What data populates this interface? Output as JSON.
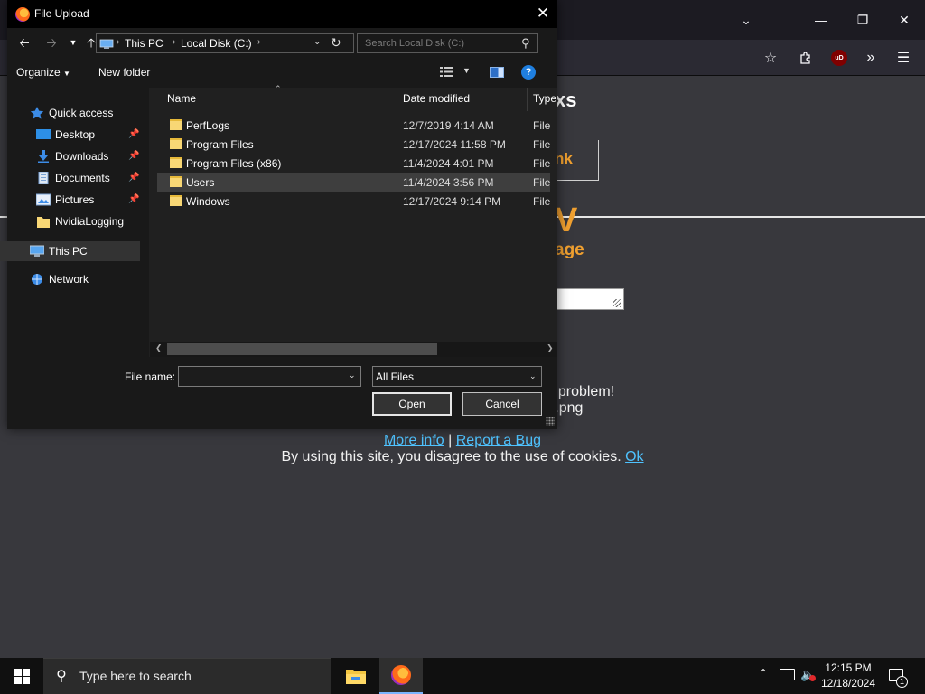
{
  "dialog": {
    "title": "File Upload",
    "address": {
      "crumbs": [
        "This PC",
        "Local Disk (C:)"
      ]
    },
    "search": {
      "placeholder": "Search Local Disk (C:)"
    },
    "toolbar": {
      "organize_label": "Organize",
      "new_folder_label": "New folder",
      "help_label": "?"
    },
    "nav": {
      "items": [
        {
          "label": "Quick access",
          "icon": "star-icon"
        },
        {
          "label": "Desktop",
          "icon": "desktop-icon",
          "pinned": true
        },
        {
          "label": "Downloads",
          "icon": "download-icon",
          "pinned": true
        },
        {
          "label": "Documents",
          "icon": "document-icon",
          "pinned": true
        },
        {
          "label": "Pictures",
          "icon": "pictures-icon",
          "pinned": true
        },
        {
          "label": "NvidiaLogging",
          "icon": "folder-icon"
        },
        {
          "label": "This PC",
          "icon": "computer-icon",
          "selected": true
        },
        {
          "label": "Network",
          "icon": "network-icon"
        }
      ]
    },
    "columns": [
      "Name",
      "Date modified",
      "Type"
    ],
    "files": [
      {
        "name": "PerfLogs",
        "date": "12/7/2019 4:14 AM",
        "type": "File folder"
      },
      {
        "name": "Program Files",
        "date": "12/17/2024 11:58 PM",
        "type": "File folder"
      },
      {
        "name": "Program Files (x86)",
        "date": "11/4/2024 4:01 PM",
        "type": "File folder"
      },
      {
        "name": "Users",
        "date": "11/4/2024 3:56 PM",
        "type": "File folder",
        "selected": true
      },
      {
        "name": "Windows",
        "date": "12/17/2024 9:14 PM",
        "type": "File folder"
      }
    ],
    "filename": {
      "label": "File name:",
      "value": ""
    },
    "filetype": {
      "value": "All Files"
    },
    "buttons": {
      "open": "Open",
      "cancel": "Cancel"
    }
  },
  "page": {
    "protip_line1": "Protip: want/need a file extension? No problem!",
    "protip_line2": "Extensions are ignored: dro.pm/o.png",
    "more_info": "More info",
    "separator": "|",
    "report_bug": "Report a Bug",
    "cookies_text": "By using this site, you disagree to the use of cookies.",
    "ok_link": "Ok",
    "peek": {
      "xs": "xs",
      "nk": "nk",
      "v": "V",
      "age": "age"
    }
  },
  "taskbar": {
    "search_placeholder": "Type here to search",
    "time": "12:15 PM",
    "date": "12/18/2024",
    "notification_count": "1"
  },
  "colors": {
    "accent_link": "#4fc3ff",
    "page_accent": "#f0a030",
    "dialog_bg": "#191919"
  }
}
